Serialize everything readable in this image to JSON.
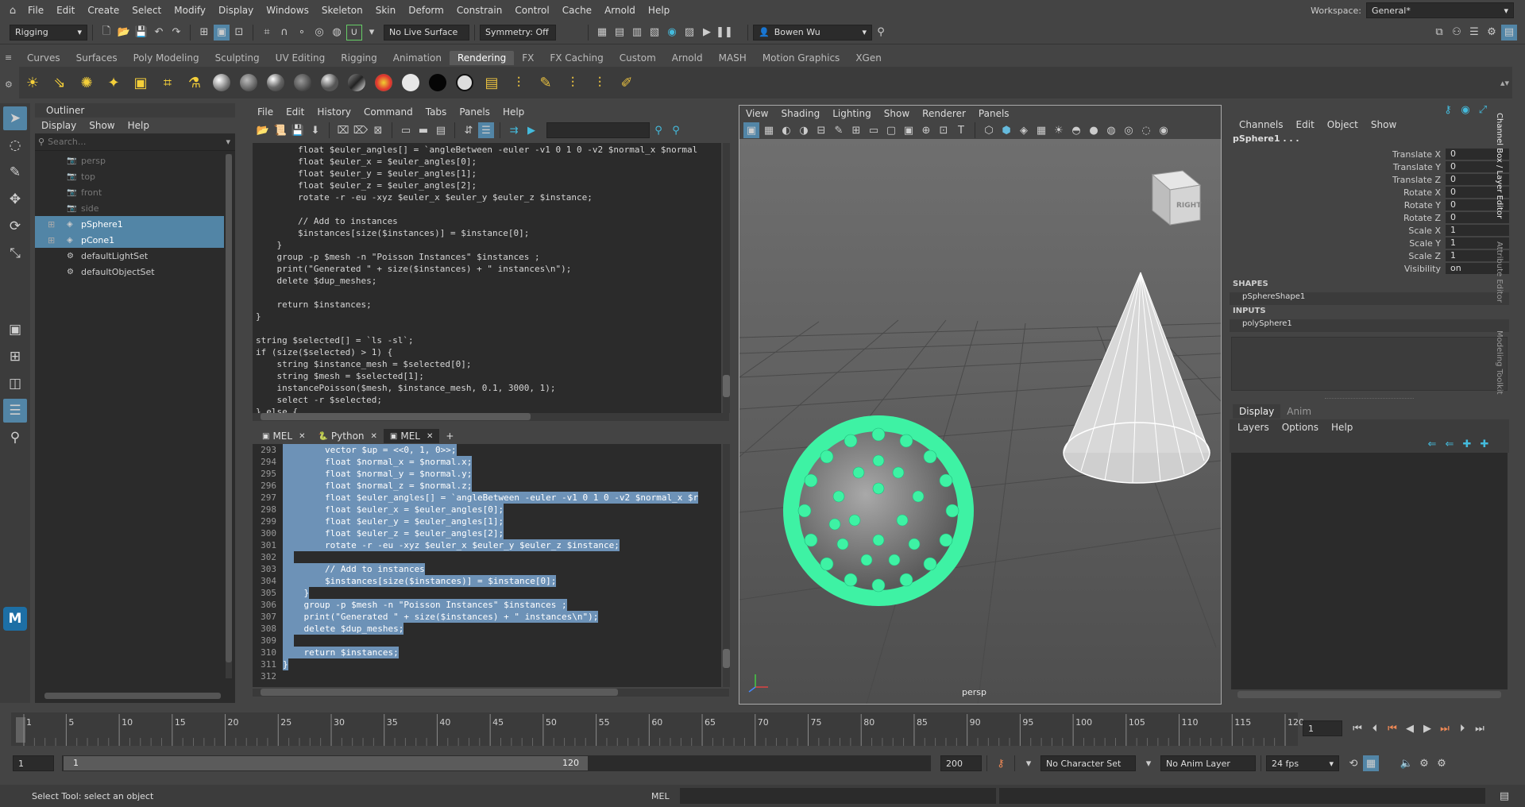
{
  "menubar": {
    "items": [
      "File",
      "Edit",
      "Create",
      "Select",
      "Modify",
      "Display",
      "Windows",
      "Skeleton",
      "Skin",
      "Deform",
      "Constrain",
      "Control",
      "Cache",
      "Arnold",
      "Help"
    ],
    "workspace_label": "Workspace:",
    "workspace_value": "General*"
  },
  "statusline": {
    "mode": "Rigging",
    "live_surface": "No Live Surface",
    "symmetry": "Symmetry: Off",
    "user": "Bowen Wu"
  },
  "shelf": {
    "tabs": [
      "Curves",
      "Surfaces",
      "Poly Modeling",
      "Sculpting",
      "UV Editing",
      "Rigging",
      "Animation",
      "Rendering",
      "FX",
      "FX Caching",
      "Custom",
      "Arnold",
      "MASH",
      "Motion Graphics",
      "XGen"
    ],
    "active": "Rendering"
  },
  "outliner": {
    "title": "Outliner",
    "menu": [
      "Display",
      "Show",
      "Help"
    ],
    "search_placeholder": "Search...",
    "items": [
      {
        "label": "persp",
        "kind": "camera",
        "state": "dim"
      },
      {
        "label": "top",
        "kind": "camera",
        "state": "dim"
      },
      {
        "label": "front",
        "kind": "camera",
        "state": "dim"
      },
      {
        "label": "side",
        "kind": "camera",
        "state": "dim"
      },
      {
        "label": "pSphere1",
        "kind": "mesh",
        "state": "selected"
      },
      {
        "label": "pCone1",
        "kind": "mesh",
        "state": "selected"
      },
      {
        "label": "defaultLightSet",
        "kind": "set",
        "state": "normal"
      },
      {
        "label": "defaultObjectSet",
        "kind": "set",
        "state": "normal"
      }
    ]
  },
  "script_editor": {
    "menu": [
      "File",
      "Edit",
      "History",
      "Command",
      "Tabs",
      "Panels",
      "Help"
    ],
    "history_lines": [
      "        float $euler_angles[] = `angleBetween -euler -v1 0 1 0 -v2 $normal_x $normal",
      "        float $euler_x = $euler_angles[0];",
      "        float $euler_y = $euler_angles[1];",
      "        float $euler_z = $euler_angles[2];",
      "        rotate -r -eu -xyz $euler_x $euler_y $euler_z $instance;",
      "",
      "        // Add to instances",
      "        $instances[size($instances)] = $instance[0];",
      "    }",
      "    group -p $mesh -n \"Poisson Instances\" $instances ;",
      "    print(\"Generated \" + size($instances) + \" instances\\n\");",
      "    delete $dup_meshes;",
      "",
      "    return $instances;",
      "}",
      "",
      "string $selected[] = `ls -sl`;",
      "if (size($selected) > 1) {",
      "    string $instance_mesh = $selected[0];",
      "    string $mesh = $selected[1];",
      "    instancePoisson($mesh, $instance_mesh, 0.1, 3000, 1);",
      "    select -r $selected;",
      "} else {"
    ],
    "tabs": [
      "MEL",
      "Python",
      "MEL"
    ],
    "active_tab": 2,
    "input_lines": [
      {
        "n": "293",
        "text": "        vector $up = <<0, 1, 0>>;"
      },
      {
        "n": "294",
        "text": "        float $normal_x = $normal.x;"
      },
      {
        "n": "295",
        "text": "        float $normal_y = $normal.y;"
      },
      {
        "n": "296",
        "text": "        float $normal_z = $normal.z;"
      },
      {
        "n": "297",
        "text": "        float $euler_angles[] = `angleBetween -euler -v1 0 1 0 -v2 $normal_x $r"
      },
      {
        "n": "298",
        "text": "        float $euler_x = $euler_angles[0];"
      },
      {
        "n": "299",
        "text": "        float $euler_y = $euler_angles[1];"
      },
      {
        "n": "300",
        "text": "        float $euler_z = $euler_angles[2];"
      },
      {
        "n": "301",
        "text": "        rotate -r -eu -xyz $euler_x $euler_y $euler_z $instance;"
      },
      {
        "n": "302",
        "text": ""
      },
      {
        "n": "303",
        "text": "        // Add to instances"
      },
      {
        "n": "304",
        "text": "        $instances[size($instances)] = $instance[0];"
      },
      {
        "n": "305",
        "text": "    }"
      },
      {
        "n": "306",
        "text": "    group -p $mesh -n \"Poisson Instances\" $instances ;"
      },
      {
        "n": "307",
        "text": "    print(\"Generated \" + size($instances) + \" instances\\n\");"
      },
      {
        "n": "308",
        "text": "    delete $dup_meshes;"
      },
      {
        "n": "309",
        "text": ""
      },
      {
        "n": "310",
        "text": "    return $instances;"
      },
      {
        "n": "311",
        "text": "}"
      },
      {
        "n": "312",
        "text": ""
      }
    ]
  },
  "viewport": {
    "menu": [
      "View",
      "Shading",
      "Lighting",
      "Show",
      "Renderer",
      "Panels"
    ],
    "camera_label": "persp",
    "viewcube_label": "RIGHT"
  },
  "channel_box": {
    "menu": [
      "Channels",
      "Edit",
      "Object",
      "Show"
    ],
    "object": "pSphere1 . . .",
    "channels": [
      {
        "label": "Translate X",
        "value": "0"
      },
      {
        "label": "Translate Y",
        "value": "0"
      },
      {
        "label": "Translate Z",
        "value": "0"
      },
      {
        "label": "Rotate X",
        "value": "0"
      },
      {
        "label": "Rotate Y",
        "value": "0"
      },
      {
        "label": "Rotate Z",
        "value": "0"
      },
      {
        "label": "Scale X",
        "value": "1"
      },
      {
        "label": "Scale Y",
        "value": "1"
      },
      {
        "label": "Scale Z",
        "value": "1"
      },
      {
        "label": "Visibility",
        "value": "on"
      }
    ],
    "shapes_header": "SHAPES",
    "shape": "pSphereShape1",
    "inputs_header": "INPUTS",
    "input": "polySphere1",
    "layer_tabs": [
      "Display",
      "Anim"
    ],
    "layer_menu": [
      "Layers",
      "Options",
      "Help"
    ],
    "side_tabs": [
      "Channel Box / Layer Editor",
      "Attribute Editor",
      "Modeling Toolkit"
    ]
  },
  "timeline": {
    "ticks": [
      "1",
      "5",
      "10",
      "15",
      "20",
      "25",
      "30",
      "35",
      "40",
      "45",
      "50",
      "55",
      "60",
      "65",
      "70",
      "75",
      "80",
      "85",
      "90",
      "95",
      "100",
      "105",
      "110",
      "115",
      "120"
    ],
    "current_frame": "1"
  },
  "range": {
    "start": "1",
    "inner_start": "1",
    "inner_end": "120",
    "end": "200",
    "character_set": "No Character Set",
    "anim_layer": "No Anim Layer",
    "fps": "24 fps"
  },
  "helpline": {
    "message": "Select Tool: select an object",
    "cmd_type": "MEL"
  },
  "colors": {
    "selection": "#5285a6",
    "instances": "#3ef2a4",
    "background": "#444444"
  }
}
